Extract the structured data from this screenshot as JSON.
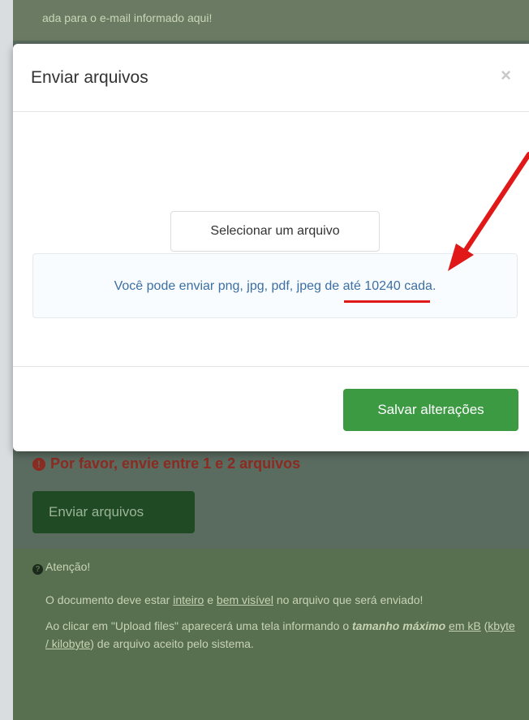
{
  "background_page": {
    "top_info_text": "ada para o e-mail informado aqui!",
    "error_text": "Por favor, envie entre 1 e 2 arquivos",
    "send_button_label": "Enviar arquivos",
    "attention": {
      "title": "Atenção!",
      "p1_before": "O documento deve estar ",
      "p1_u1": "inteiro",
      "p1_mid": " e ",
      "p1_u2": "bem visível",
      "p1_after": " no arquivo que será enviado!",
      "p2_before": "Ao clicar em \"Upload files\" aparecerá uma tela informando o ",
      "p2_bold": "tamanho máximo",
      "p2_space": " ",
      "p2_u1": "em kB",
      "p2_mid": " (",
      "p2_u2": "kbyte / kilobyte",
      "p2_after": ") de arquivo aceito pelo sistema."
    }
  },
  "modal": {
    "title": "Enviar arquivos",
    "close_symbol": "×",
    "select_button_label": "Selecionar um arquivo",
    "info_before": "Você pode enviar png, jpg, pdf, jpeg de ",
    "info_limit": "até 10240",
    "info_after": " cada.",
    "save_button_label": "Salvar alterações"
  },
  "colors": {
    "annotation": "#e01818",
    "save_button": "#3c9a43",
    "info_text": "#3b6fa3"
  }
}
